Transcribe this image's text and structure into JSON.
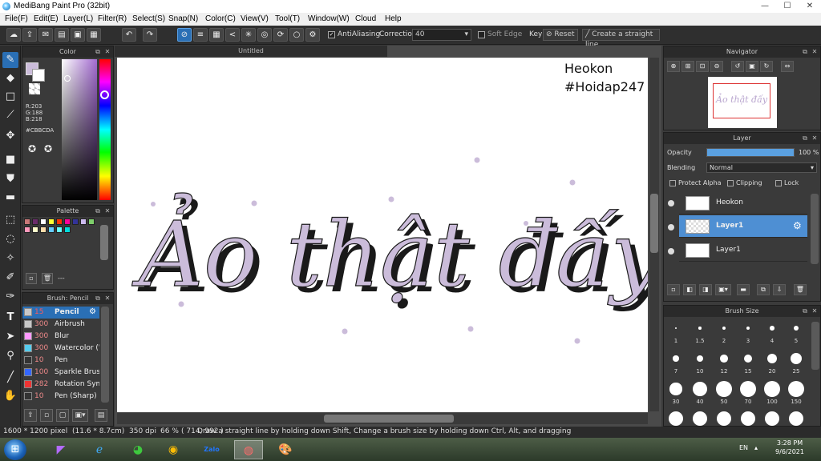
{
  "window": {
    "title": "MediBang Paint Pro (32bit)",
    "min": "—",
    "max": "☐",
    "close": "✕"
  },
  "menu": [
    "File(F)",
    "Edit(E)",
    "Layer(L)",
    "Filter(R)",
    "Select(S)",
    "Snap(N)",
    "Color(C)",
    "View(V)",
    "Tool(T)",
    "Window(W)",
    "Cloud",
    "Help"
  ],
  "toolbar": {
    "antialiasing": "AntiAliasing",
    "correction_label": "Correction",
    "correction_value": "40",
    "soft_edge": "Soft Edge",
    "key_label": "Key",
    "reset": "Reset",
    "straight_line": "Create a straight line"
  },
  "color_panel": {
    "title": "Color",
    "r": "R:203",
    "g": "G:188",
    "b": "B:218",
    "hex": "#CBBCDA",
    "current_color": "#CBBCDA"
  },
  "palette_panel": {
    "title": "Palette",
    "colors": [
      "#c87878",
      "#6b2d6b",
      "#ffffff",
      "#ffff33",
      "#ff3300",
      "#ff0099",
      "#333399",
      "#ccbbee",
      "#7ecf6b",
      "#ff99bb",
      "#ffffcc",
      "#ffddaa",
      "#66ccff",
      "#66ffff",
      "#00dddd"
    ],
    "footer": "---"
  },
  "brush_panel": {
    "title": "Brush: Pencil",
    "brushes": [
      {
        "size": "15",
        "name": "Pencil",
        "color": "#c8c8c8"
      },
      {
        "size": "300",
        "name": "Airbrush",
        "color": "#c8c8c8"
      },
      {
        "size": "300",
        "name": "Blur",
        "color": "#ff99ff"
      },
      {
        "size": "300",
        "name": "Watercolor (W",
        "color": "#55ccee"
      },
      {
        "size": "10",
        "name": "Pen",
        "color": "#333333"
      },
      {
        "size": "100",
        "name": "Sparkle Brush",
        "color": "#3366ff"
      },
      {
        "size": "282",
        "name": "Rotation Sym",
        "color": "#ee3333"
      },
      {
        "size": "10",
        "name": "Pen (Sharp)",
        "color": "#333333"
      }
    ]
  },
  "document": {
    "tab": "Untitled",
    "note_line1": "Heokon",
    "note_line2": "#Hoidap247",
    "artwork_text": "Ảo thật đấy"
  },
  "navigator": {
    "title": "Navigator",
    "preview_text": "Ảo thật đấy"
  },
  "layer_panel": {
    "title": "Layer",
    "opacity_label": "Opacity",
    "opacity_value": "100 %",
    "opacity_fraction": 1.0,
    "blending_label": "Blending",
    "blending_value": "Normal",
    "protect_alpha": "Protect Alpha",
    "clipping": "Clipping",
    "lock": "Lock",
    "layers": [
      {
        "name": "Heokon",
        "selected": false
      },
      {
        "name": "Layer1",
        "selected": true
      },
      {
        "name": "Layer1",
        "selected": false
      }
    ]
  },
  "brush_size_panel": {
    "title": "Brush Size",
    "sizes": [
      "1",
      "1.5",
      "2",
      "3",
      "4",
      "5",
      "7",
      "10",
      "12",
      "15",
      "20",
      "25",
      "30",
      "40",
      "50",
      "70",
      "100",
      "150"
    ]
  },
  "status": {
    "dims": "1600 * 1200 pixel",
    "cm": "(11.6 * 8.7cm)",
    "dpi": "350 dpi",
    "zoom": "66 %",
    "coords": "( 714, 992 )",
    "hint": "Draw a straight line by holding down Shift, Change a brush size by holding down Ctrl, Alt, and dragging"
  },
  "taskbar": {
    "lang": "EN",
    "time": "3:28 PM",
    "date": "9/6/2021",
    "zalo": "Zalo"
  }
}
